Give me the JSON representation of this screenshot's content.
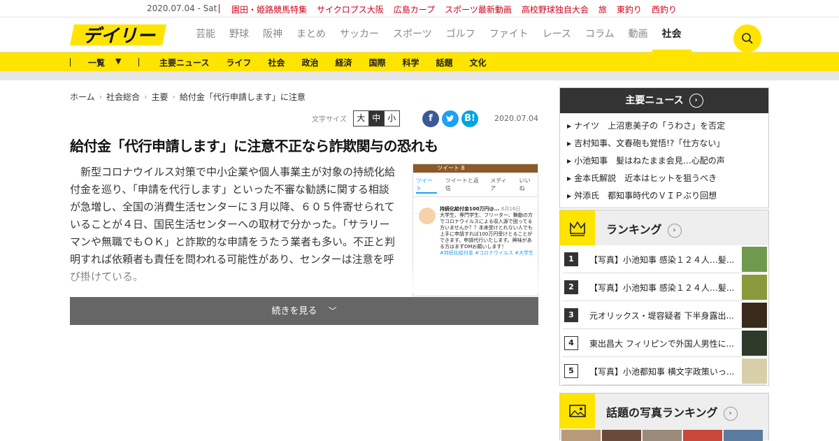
{
  "topbar": {
    "date": "2020.07.04 - Sat",
    "links": [
      "園田・姫路競馬特集",
      "サイクロプス大阪",
      "広島カープ",
      "スポーツ最新動画",
      "高校野球独自大会",
      "旅",
      "東釣り",
      "西釣り"
    ]
  },
  "header": {
    "logo": "デイリー",
    "nav": [
      "芸能",
      "野球",
      "阪神",
      "まとめ",
      "サッカー",
      "スポーツ",
      "ゴルフ",
      "ファイト",
      "レース",
      "コラム",
      "動画",
      "社会"
    ],
    "active": "社会"
  },
  "subnav": {
    "list_label": "一覧",
    "categories": [
      "主要ニュース",
      "ライフ",
      "社会",
      "政治",
      "経済",
      "国際",
      "科学",
      "話題",
      "文化"
    ]
  },
  "breadcrumb": [
    "ホーム",
    "社会総合",
    "主要",
    "給付金「代行申請します」に注意"
  ],
  "article": {
    "fontsize_label": "文字サイズ",
    "fontsize_options": [
      "大",
      "中",
      "小"
    ],
    "date": "2020.07.04",
    "title": "給付金「代行申請します」に注意不正なら詐欺関与の恐れも",
    "body": "新型コロナウイルス対策で中小企業や個人事業主が対象の持続化給付金を巡り、「申請を代行します」といった不審な勧誘に関する相談が急増し、全国の消費生活センターに３月以降、６０５件寄せられていることが４日、国民生活センターへの取材で分かった。「サラリーマンや無職でもＯＫ」と詐欺的な申請をうたう業者も多い。不正と判明すれば依頼者も責任を問われる可能性があり、センターは注意を呼び掛けている。",
    "readmore": "続きを見る"
  },
  "photo": {
    "tab_count": "ツイート 8",
    "tabs": [
      "ツイート",
      "ツイートと返信",
      "メディア",
      "いいね"
    ],
    "author": "持続化給付金100万円@...",
    "date": "6月16日",
    "text": "大学生、専門学生、フリーター、舞動の方でコロナウイルスによる収入源で困ってる方いませんか？？本来受けとれない人でも上手に申請すれば100万円受けとることができます。申請代行いたします。興味がある方はまずDMお願いします！",
    "tags": "#持続化給付金 #コロナウイルス #大学生"
  },
  "sidebar": {
    "news_title": "主要ニュース",
    "news": [
      "ナイツ　上沼恵美子の「うわさ」を否定",
      "吉村知事、文春砲も覚悟!?「仕方ない」",
      "小池知事　髪はねたまま会見…心配の声",
      "金本氏解説　近本はヒットを狙うべき",
      "舛添氏　都知事時代のＶＩＰぶり回想"
    ],
    "ranking_title": "ランキング",
    "ranking": [
      {
        "n": "1",
        "text": "【写真】小池知事 感染１２４人…髪..."
      },
      {
        "n": "2",
        "text": "【写真】小池知事 感染１２４人…髪..."
      },
      {
        "n": "3",
        "text": "元オリックス・堤容疑者 下半身露出..."
      },
      {
        "n": "4",
        "text": "東出昌大 フィリピンで外国人男性に..."
      },
      {
        "n": "5",
        "text": "【写真】小池都知事 横文字政策いっ..."
      }
    ],
    "photorank_title": "話題の写真ランキング"
  }
}
